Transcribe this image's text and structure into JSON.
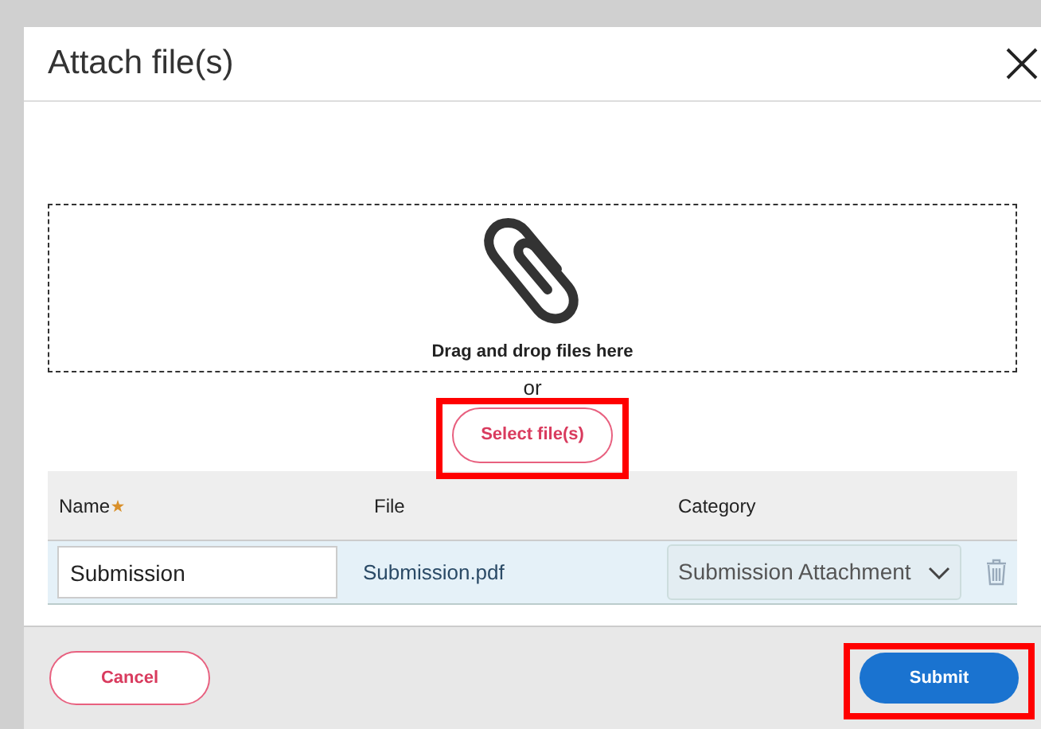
{
  "dialog": {
    "title": "Attach file(s)"
  },
  "dropzone": {
    "text": "Drag and drop files here",
    "separator": "or",
    "select_button": {
      "label": "Select file(s)",
      "highlighted": true
    }
  },
  "table": {
    "columns": [
      {
        "label": "Name",
        "required": true
      },
      {
        "label": "File",
        "required": false
      },
      {
        "label": "Category",
        "required": false
      }
    ],
    "rows": [
      {
        "name": "Submission",
        "file": "Submission.pdf",
        "category": "Submission Attachment"
      }
    ]
  },
  "footer": {
    "cancel": {
      "label": "Cancel",
      "highlighted": false
    },
    "submit": {
      "label": "Submit",
      "highlighted": true
    }
  }
}
